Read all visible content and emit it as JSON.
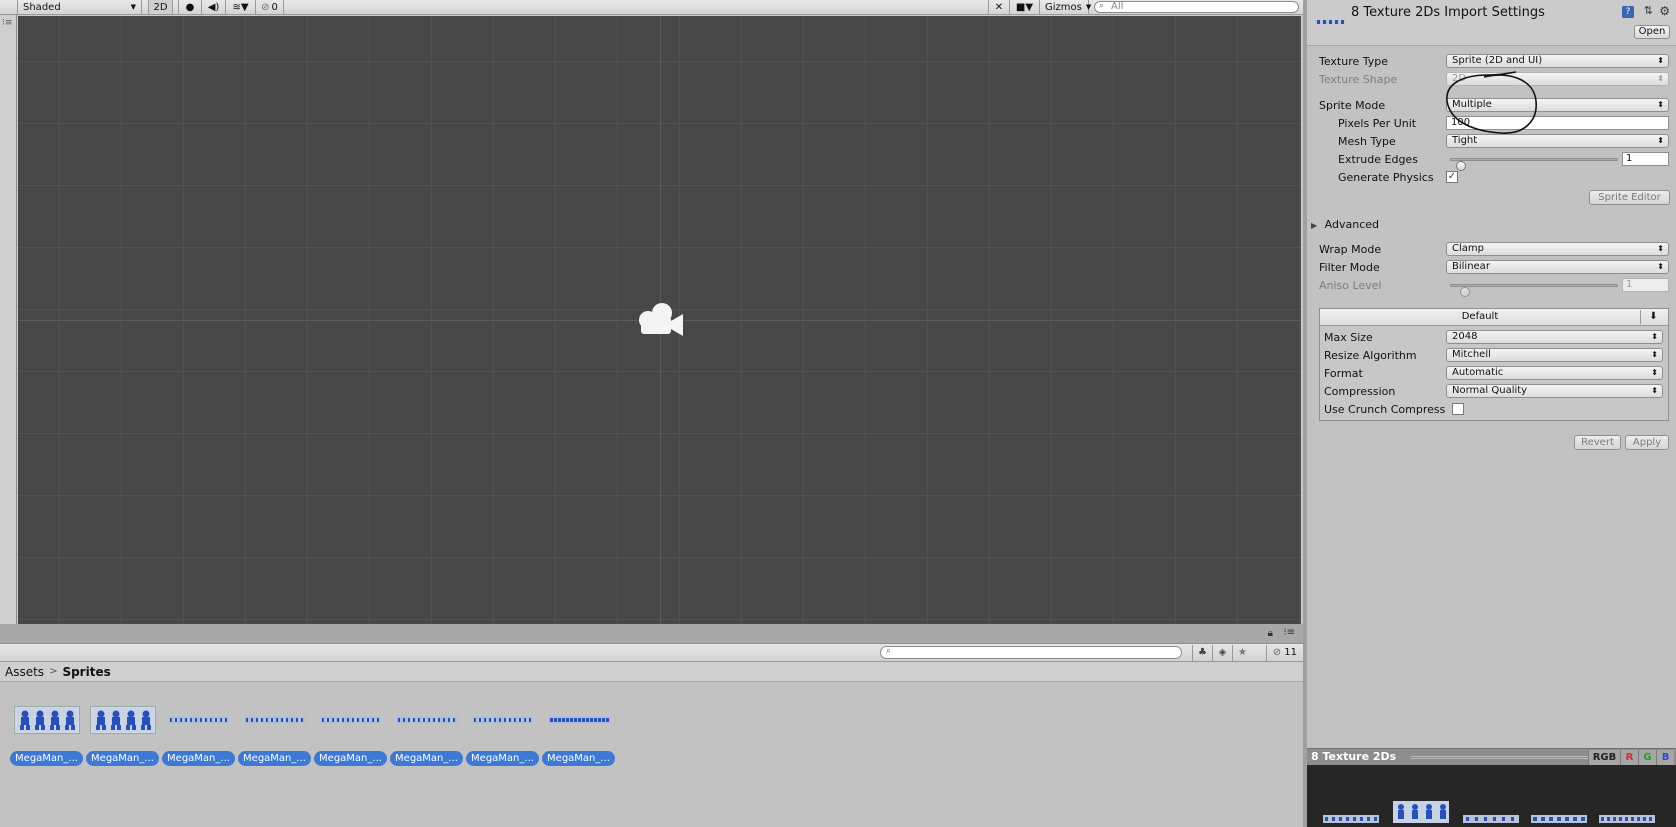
{
  "scene": {
    "shading_mode": "Shaded",
    "mode_2d": "2D",
    "hidden_count": "0",
    "gizmos_label": "Gizmos",
    "search_placeholder": "All"
  },
  "project": {
    "breadcrumb": [
      "Assets",
      "Sprites"
    ],
    "hidden_count": "11",
    "assets": [
      {
        "label": "MegaMan_...",
        "thumb": "runners-4"
      },
      {
        "label": "MegaMan_...",
        "thumb": "runners-4b"
      },
      {
        "label": "MegaMan_...",
        "thumb": "strip"
      },
      {
        "label": "MegaMan_...",
        "thumb": "strip"
      },
      {
        "label": "MegaMan_...",
        "thumb": "strip"
      },
      {
        "label": "MegaMan_...",
        "thumb": "strip"
      },
      {
        "label": "MegaMan_...",
        "thumb": "strip"
      },
      {
        "label": "MegaMan_...",
        "thumb": "strip-dense"
      }
    ]
  },
  "inspector": {
    "title": "8 Texture 2Ds Import Settings",
    "open_label": "Open",
    "help_icon": "?",
    "texture_type": {
      "label": "Texture Type",
      "value": "Sprite (2D and UI)"
    },
    "texture_shape": {
      "label": "Texture Shape",
      "value": "2D"
    },
    "sprite_mode": {
      "label": "Sprite Mode",
      "value": "Multiple"
    },
    "pixels_per_unit": {
      "label": "Pixels Per Unit",
      "value": "100"
    },
    "mesh_type": {
      "label": "Mesh Type",
      "value": "Tight"
    },
    "extrude_edges": {
      "label": "Extrude Edges",
      "value": "1",
      "slider_fraction": 0.03
    },
    "generate_physics": {
      "label": "Generate Physics",
      "checked": true
    },
    "sprite_editor_label": "Sprite Editor",
    "advanced_label": "Advanced",
    "wrap_mode": {
      "label": "Wrap Mode",
      "value": "Clamp"
    },
    "filter_mode": {
      "label": "Filter Mode",
      "value": "Bilinear"
    },
    "aniso_level": {
      "label": "Aniso Level",
      "value": "1",
      "slider_fraction": 0.06
    },
    "platform": {
      "tab_label": "Default",
      "max_size": {
        "label": "Max Size",
        "value": "2048"
      },
      "resize_algorithm": {
        "label": "Resize Algorithm",
        "value": "Mitchell"
      },
      "format": {
        "label": "Format",
        "value": "Automatic"
      },
      "compression": {
        "label": "Compression",
        "value": "Normal Quality"
      },
      "use_crunch": {
        "label": "Use Crunch Compress",
        "checked": false
      }
    },
    "revert_label": "Revert",
    "apply_label": "Apply"
  },
  "preview": {
    "title": "8 Texture 2Ds",
    "channels": [
      "RGB",
      "R",
      "G",
      "B"
    ],
    "channel_colors": [
      "#222222",
      "#d42a2a",
      "#2a9a2a",
      "#2a4ad4"
    ]
  }
}
